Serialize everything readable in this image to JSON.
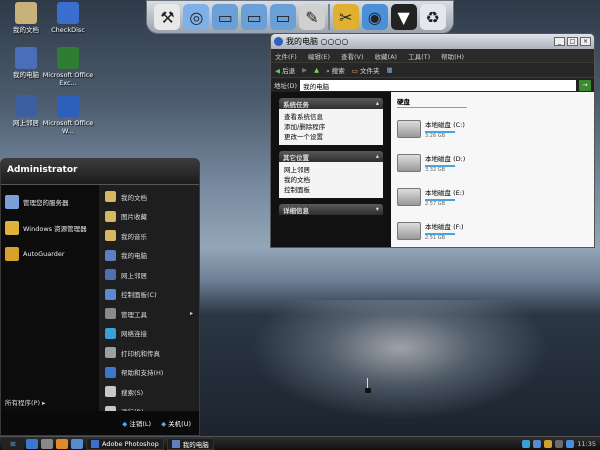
{
  "desktop": {
    "icons": [
      {
        "label": "我的文档",
        "icon": "my-documents-icon",
        "color": "#c8b27a"
      },
      {
        "label": "CheckDisc",
        "icon": "usb-icon",
        "color": "#3a6fcf"
      },
      {
        "label": "我的电脑",
        "icon": "my-computer-icon",
        "color": "#4a6fb8"
      },
      {
        "label": "Microsoft Office Exc...",
        "icon": "excel-icon",
        "color": "#2f7d32"
      },
      {
        "label": "网上邻居",
        "icon": "network-icon",
        "color": "#3d5fa0"
      },
      {
        "label": "Microsoft Office W...",
        "icon": "word-icon",
        "color": "#2d5fbd"
      }
    ]
  },
  "dock": {
    "items": [
      "tools-icon",
      "internet-icon",
      "folder-icon",
      "folder-open-icon",
      "folder-tools-icon",
      "settings-icon",
      "utilities-icon",
      "globe-icon",
      "tshirt-icon",
      "recycle-bin-icon"
    ]
  },
  "explorer": {
    "title": "我的电脑 ○○○○",
    "controls": [
      "_",
      "□",
      "×"
    ],
    "menu": [
      "文件(F)",
      "编辑(E)",
      "查看(V)",
      "收藏(A)",
      "工具(T)",
      "帮助(H)"
    ],
    "toolbar": {
      "back": "后退",
      "search": "搜索",
      "folders": "文件夹"
    },
    "address_label": "地址(D)",
    "address_value": "我的电脑",
    "system_tasks": {
      "title": "系统任务",
      "items": [
        "查看系统信息",
        "添加/删除程序",
        "更改一个设置"
      ]
    },
    "other_places": {
      "title": "其它位置",
      "items": [
        "网上邻居",
        "我的文档",
        "控制面板"
      ]
    },
    "details": {
      "title": "详细信息"
    },
    "drives_header": "硬盘",
    "drives": [
      {
        "name": "本地磁盘 (C:)",
        "size": "3.26 GB"
      },
      {
        "name": "本地磁盘 (D:)",
        "size": "3.32 GB"
      },
      {
        "name": "本地磁盘 (E:)",
        "size": "2.57 GB"
      },
      {
        "name": "本地磁盘 (F:)",
        "size": "2.51 GB"
      }
    ]
  },
  "start_menu": {
    "user": "Administrator",
    "pinned": [
      {
        "label": "管理您的服务器",
        "icon": "server-manager-icon",
        "color": "#7a9ed8"
      },
      {
        "label": "Windows 资源管理器",
        "icon": "explorer-icon",
        "color": "#e0b13a"
      },
      {
        "label": "AutoGuarder",
        "icon": "shield-icon",
        "color": "#d6a02a"
      }
    ],
    "all_programs": "所有程序(P)",
    "right": [
      {
        "label": "我的文档",
        "icon": "my-documents-icon",
        "color": "#d7b75f",
        "arrow": false
      },
      {
        "label": "图片收藏",
        "icon": "my-pictures-icon",
        "color": "#d7b75f",
        "arrow": false
      },
      {
        "label": "我的音乐",
        "icon": "my-music-icon",
        "color": "#d7b75f",
        "arrow": false
      },
      {
        "label": "我的电脑",
        "icon": "my-computer-icon",
        "color": "#5f7fc0",
        "arrow": false
      },
      {
        "label": "网上邻居",
        "icon": "network-icon",
        "color": "#4f6fb0",
        "arrow": false
      },
      {
        "label": "控制面板(C)",
        "icon": "control-panel-icon",
        "color": "#5a8ad0",
        "arrow": false
      },
      {
        "label": "管理工具",
        "icon": "admin-tools-icon",
        "color": "#8a8a8a",
        "arrow": true
      },
      {
        "label": "网络连接",
        "icon": "network-connections-icon",
        "color": "#3aa0d8",
        "arrow": false
      },
      {
        "label": "打印机和传真",
        "icon": "printer-icon",
        "color": "#9aa0a8",
        "arrow": false
      },
      {
        "label": "帮助和支持(H)",
        "icon": "help-icon",
        "color": "#3a78d0",
        "arrow": false
      },
      {
        "label": "搜索(S)",
        "icon": "search-icon",
        "color": "#c8c8c8",
        "arrow": false
      },
      {
        "label": "运行(R)...",
        "icon": "run-icon",
        "color": "#c8c8c8",
        "arrow": false
      }
    ],
    "logoff": "注销(L)",
    "shutdown": "关机(U)"
  },
  "taskbar": {
    "tasks": [
      {
        "label": "Adobe Photoshop",
        "icon": "photoshop-icon"
      },
      {
        "label": "我的电脑",
        "icon": "my-computer-icon"
      }
    ],
    "clock": "11:35"
  }
}
